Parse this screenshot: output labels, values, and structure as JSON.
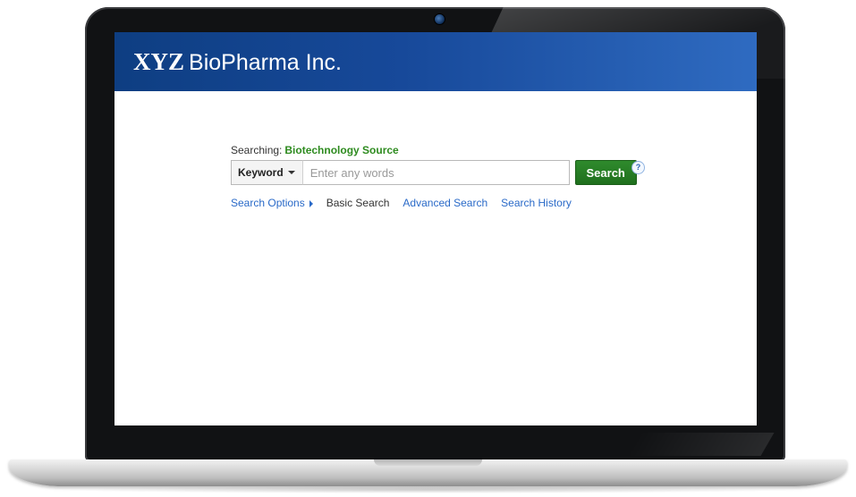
{
  "header": {
    "logo_strong": "XYZ",
    "logo_rest": "BioPharma Inc."
  },
  "search": {
    "searching_label": "Searching:",
    "database": "Biotechnology Source",
    "field_select_value": "Keyword",
    "input_value": "",
    "input_placeholder": "Enter any words",
    "button_label": "Search",
    "help_label": "?"
  },
  "links": {
    "search_options": "Search Options",
    "basic_search": "Basic Search",
    "advanced_search": "Advanced Search",
    "search_history": "Search History"
  },
  "colors": {
    "header_blue": "#17499a",
    "search_green": "#2e8b1f",
    "link_blue": "#2a6ac8"
  },
  "icons": {
    "field_dropdown": "chevron-down-icon",
    "search_options": "triangle-right-icon",
    "help": "help-icon",
    "camera": "webcam-icon"
  }
}
